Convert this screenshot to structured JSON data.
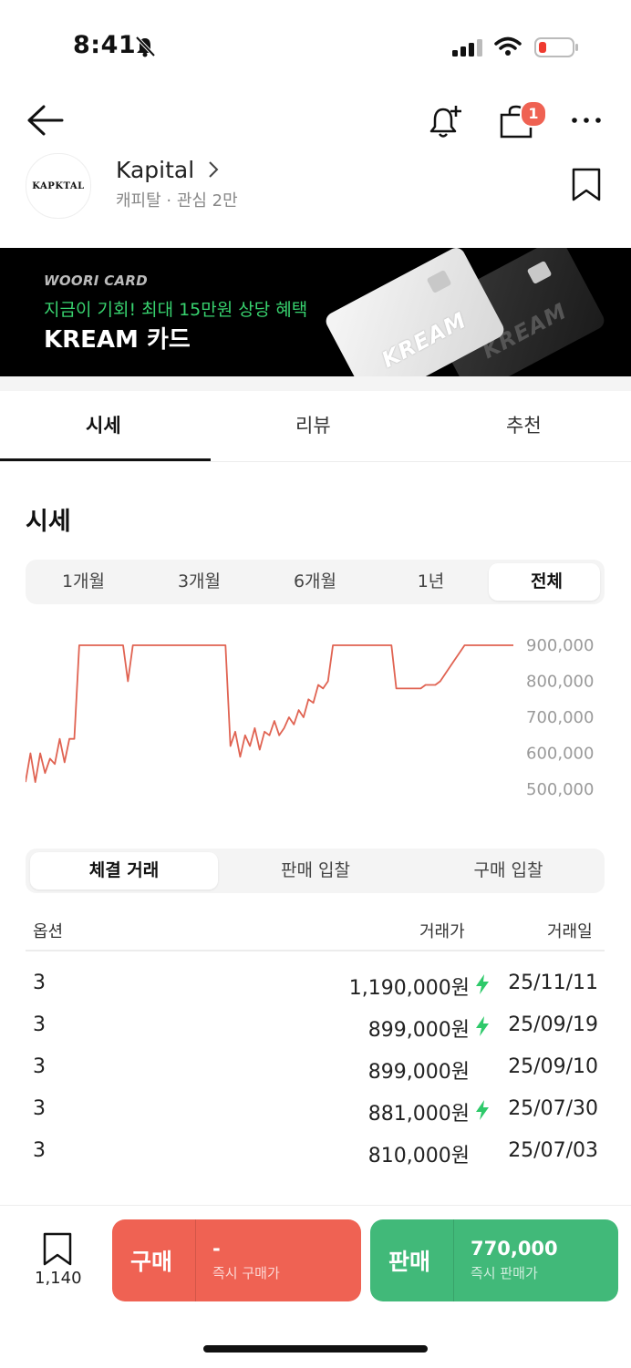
{
  "status_bar": {
    "time": "8:41"
  },
  "header": {
    "cart_badge": "1"
  },
  "brand": {
    "logo_text": "KAPKTAL",
    "name": "Kapital",
    "subtitle": "캐피탈 · 관심 2만"
  },
  "banner": {
    "eyebrow": "WOORI CARD",
    "headline": "지금이 기회! 최대 15만원 상당 혜택",
    "title": "KREAM 카드",
    "card_text": "KREAM"
  },
  "tabs": [
    {
      "label": "시세"
    },
    {
      "label": "리뷰"
    },
    {
      "label": "추천"
    }
  ],
  "market": {
    "title": "시세",
    "periods": [
      "1개월",
      "3개월",
      "6개월",
      "1년",
      "전체"
    ],
    "active_period": "전체"
  },
  "chart_data": {
    "type": "line",
    "color": "#e06352",
    "y_ticks": [
      "900,000",
      "800,000",
      "700,000",
      "600,000",
      "500,000"
    ],
    "ylim": [
      500000,
      900000
    ],
    "x": [
      0,
      1,
      2,
      3,
      4,
      5,
      6,
      7,
      8,
      9,
      10,
      11,
      12,
      13,
      14,
      15,
      16,
      17,
      18,
      19,
      20,
      21,
      22,
      23,
      24,
      25,
      26,
      27,
      28,
      29,
      30,
      31,
      32,
      33,
      34,
      35,
      36,
      37,
      38,
      39,
      40,
      41,
      42,
      43,
      44,
      45,
      46,
      47,
      48,
      49,
      50,
      51,
      52,
      53,
      54,
      55,
      56,
      57,
      58,
      59,
      60,
      61,
      62,
      63,
      64,
      65,
      66,
      67,
      68,
      69,
      70,
      71,
      72,
      73,
      74,
      75,
      76,
      77,
      78,
      79,
      80,
      81,
      82,
      83,
      84,
      85,
      86,
      87,
      88,
      89,
      90,
      91,
      92,
      93,
      94,
      95,
      96,
      97,
      98,
      99,
      100
    ],
    "values": [
      520000,
      600000,
      520000,
      600000,
      545000,
      585000,
      570000,
      640000,
      575000,
      640000,
      640000,
      900000,
      900000,
      900000,
      900000,
      900000,
      900000,
      900000,
      900000,
      900000,
      900000,
      800000,
      900000,
      900000,
      900000,
      900000,
      900000,
      900000,
      900000,
      900000,
      900000,
      900000,
      900000,
      900000,
      900000,
      900000,
      900000,
      900000,
      900000,
      900000,
      900000,
      900000,
      620000,
      660000,
      590000,
      650000,
      620000,
      670000,
      610000,
      660000,
      650000,
      690000,
      650000,
      670000,
      700000,
      680000,
      720000,
      700000,
      750000,
      740000,
      790000,
      780000,
      800000,
      900000,
      900000,
      900000,
      900000,
      900000,
      900000,
      900000,
      900000,
      900000,
      900000,
      900000,
      900000,
      900000,
      780000,
      780000,
      780000,
      780000,
      780000,
      780000,
      790000,
      790000,
      790000,
      800000,
      820000,
      840000,
      860000,
      880000,
      900000,
      900000,
      900000,
      900000,
      900000,
      900000,
      900000,
      900000,
      900000,
      900000,
      900000
    ]
  },
  "trade_tabs": {
    "items": [
      "체결 거래",
      "판매 입찰",
      "구매 입찰"
    ],
    "active": "체결 거래"
  },
  "table": {
    "headers": {
      "option": "옵션",
      "price": "거래가",
      "date": "거래일"
    },
    "rows": [
      {
        "option": "3",
        "price": "1,190,000원",
        "date": "25/11/11",
        "fast": true
      },
      {
        "option": "3",
        "price": "899,000원",
        "date": "25/09/19",
        "fast": true
      },
      {
        "option": "3",
        "price": "899,000원",
        "date": "25/09/10",
        "fast": false
      },
      {
        "option": "3",
        "price": "881,000원",
        "date": "25/07/30",
        "fast": true
      },
      {
        "option": "3",
        "price": "810,000원",
        "date": "25/07/03",
        "fast": false
      }
    ]
  },
  "bottom": {
    "wish_count": "1,140",
    "buy": {
      "label": "구매",
      "price": "-",
      "sub": "즉시 구매가"
    },
    "sell": {
      "label": "판매",
      "price": "770,000",
      "sub": "즉시 판매가"
    }
  },
  "colors": {
    "buy": "#ef6253",
    "sell": "#41b979",
    "fast_icon": "#2ec96a"
  }
}
